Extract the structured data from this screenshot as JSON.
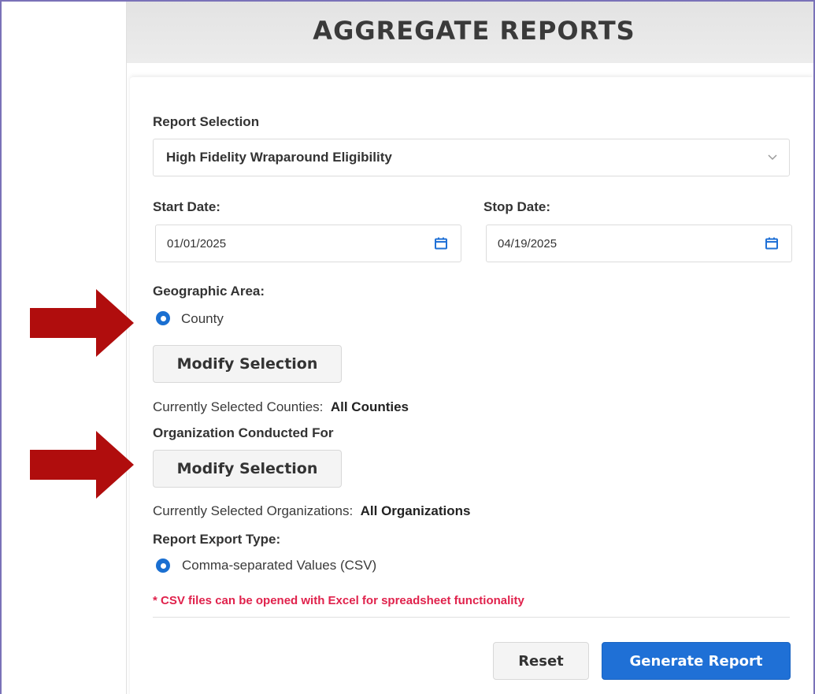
{
  "header": {
    "title": "AGGREGATE REPORTS"
  },
  "report_selection": {
    "label": "Report Selection",
    "value": "High Fidelity Wraparound Eligibility",
    "icon": "chevron-down-icon"
  },
  "dates": {
    "start_label": "Start Date:",
    "start_value": "01/01/2025",
    "stop_label": "Stop Date:",
    "stop_value": "04/19/2025",
    "icon": "calendar-icon"
  },
  "geographic_area": {
    "label": "Geographic Area:",
    "option": "County",
    "modify_label": "Modify Selection",
    "current_label": "Currently Selected Counties:",
    "current_value": "All Counties"
  },
  "organization": {
    "label": "Organization Conducted For",
    "modify_label": "Modify Selection",
    "current_label": "Currently Selected Organizations:",
    "current_value": "All Organizations"
  },
  "export": {
    "label": "Report Export Type:",
    "option": "Comma-separated Values (CSV)",
    "note": "* CSV files can be opened with Excel for spreadsheet functionality"
  },
  "actions": {
    "reset_label": "Reset",
    "generate_label": "Generate Report"
  },
  "colors": {
    "accent": "#1f70d6",
    "warning": "#e0224c",
    "arrow": "#b00d0d"
  }
}
